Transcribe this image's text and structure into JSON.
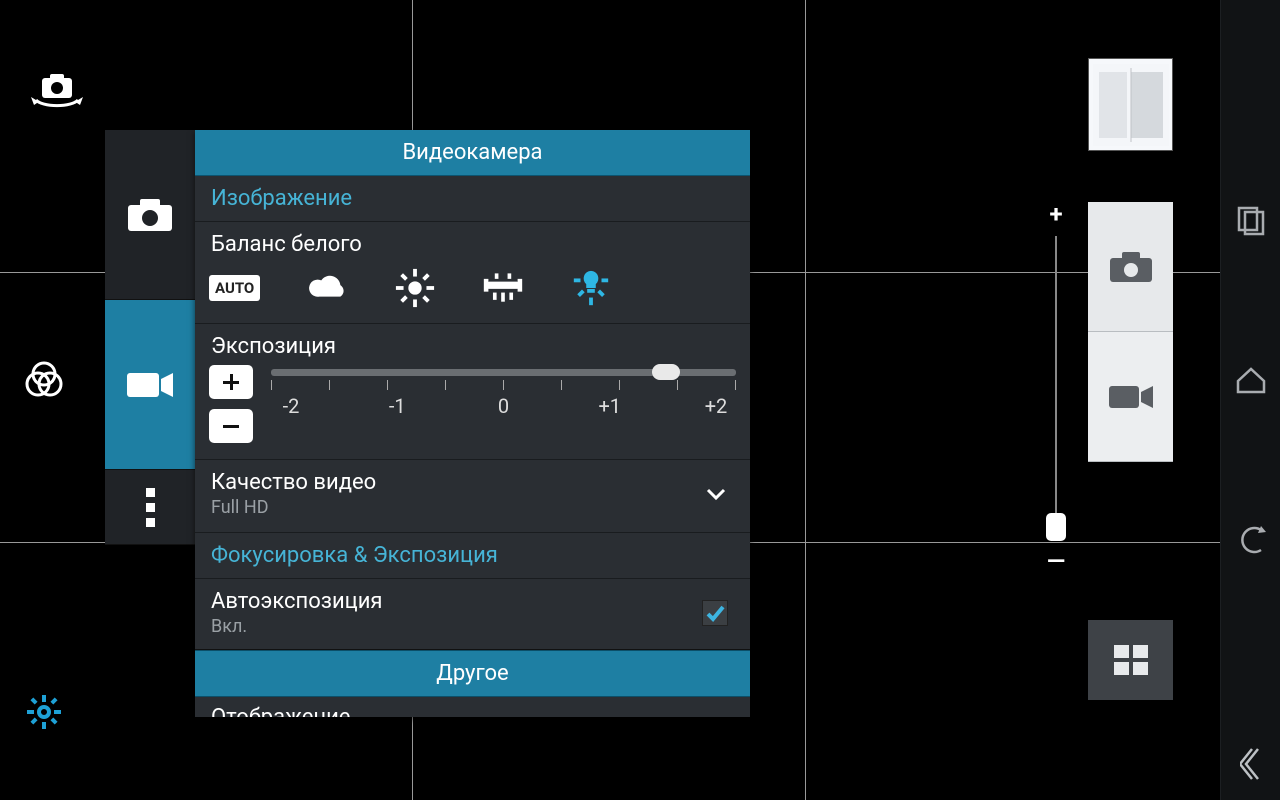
{
  "panel": {
    "title": "Видеокамера",
    "section_image": "Изображение",
    "white_balance": {
      "label": "Баланс белого",
      "auto_chip": "AUTO"
    },
    "exposure": {
      "label": "Экспозиция",
      "value": 0.85,
      "ticks": [
        "-2",
        "-1",
        "0",
        "+1",
        "+2"
      ]
    },
    "quality": {
      "label": "Качество видео",
      "value": "Full HD"
    },
    "section_focus": "Фокусировка & Экспозиция",
    "autoexposure": {
      "label": "Автоэкспозиция",
      "value": "Вкл.",
      "checked": true
    },
    "section_other": "Другое",
    "peek": "Отображение"
  },
  "zoom": {
    "plus": "+",
    "minus": "—",
    "position": 0.96
  }
}
